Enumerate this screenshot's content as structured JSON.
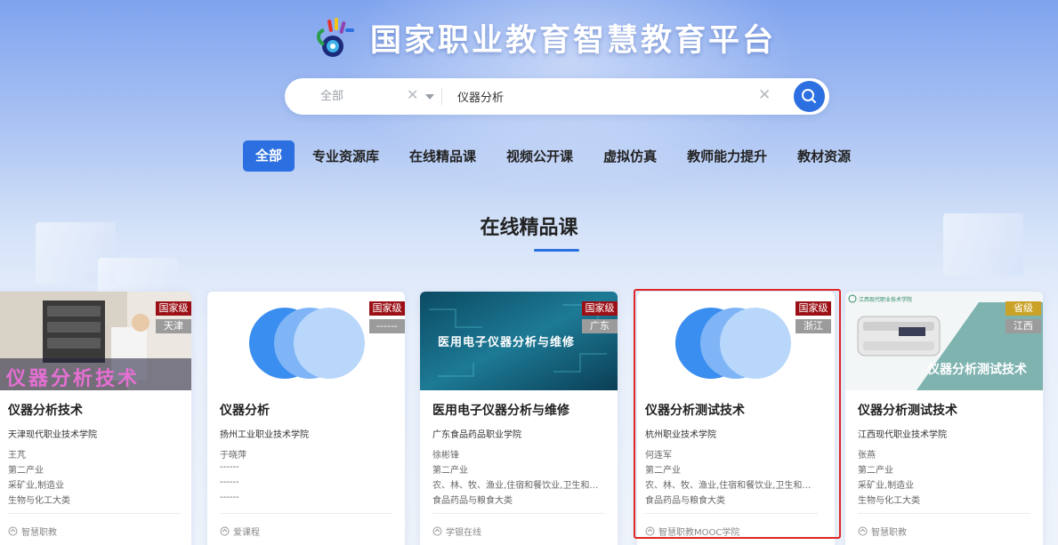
{
  "colors": {
    "accent": "#2b6fe0",
    "badge_national": "#9b1016",
    "badge_provincial": "#c9a227",
    "region_badge": "#9b9b9b",
    "highlight": "#e02626"
  },
  "header": {
    "title": "国家职业教育智慧教育平台"
  },
  "search": {
    "scope": "全部",
    "query": "仪器分析"
  },
  "tabs": [
    {
      "label": "全部",
      "active": true
    },
    {
      "label": "专业资源库"
    },
    {
      "label": "在线精品课"
    },
    {
      "label": "视频公开课"
    },
    {
      "label": "虚拟仿真"
    },
    {
      "label": "教师能力提升"
    },
    {
      "label": "教材资源"
    }
  ],
  "section": {
    "title": "在线精品课"
  },
  "cards": [
    {
      "title": "仪器分析技术",
      "cover_text": "仪器分析技术",
      "level": "国家级",
      "region": "天津",
      "school": "天津现代职业技术学院",
      "teacher": "王芃",
      "industry": "第二产业",
      "sector": "采矿业,制造业",
      "category": "生物与化工大类",
      "platform": "智慧职教"
    },
    {
      "title": "仪器分析",
      "level": "国家级",
      "region": "------",
      "school": "扬州工业职业技术学院",
      "teacher": "于晓萍",
      "industry": "------",
      "sector": "------",
      "category": "------",
      "platform": "爱课程"
    },
    {
      "title": "医用电子仪器分析与维修",
      "cover_text": "医用电子仪器分析与维修",
      "level": "国家级",
      "region": "广东",
      "school": "广东食品药品职业学院",
      "teacher": "徐彬锋",
      "industry": "第二产业",
      "sector": "农、林、牧、渔业,住宿和餐饮业,卫生和…",
      "category": "食品药品与粮食大类",
      "platform": "学银在线"
    },
    {
      "title": "仪器分析测试技术",
      "level": "国家级",
      "region": "浙江",
      "school": "杭州职业技术学院",
      "teacher": "何连军",
      "industry": "第二产业",
      "sector": "农、林、牧、渔业,住宿和餐饮业,卫生和…",
      "category": "食品药品与粮食大类",
      "platform": "智慧职教MOOC学院",
      "highlighted": true
    },
    {
      "title": "仪器分析测试技术",
      "cover_text": "仪器分析测试技术",
      "cover_header": "江西现代职业技术学院",
      "level": "省级",
      "region": "江西",
      "school": "江西现代职业技术学院",
      "teacher": "张燕",
      "industry": "第二产业",
      "sector": "采矿业,制造业",
      "category": "生物与化工大类",
      "platform": "智慧职教"
    }
  ]
}
